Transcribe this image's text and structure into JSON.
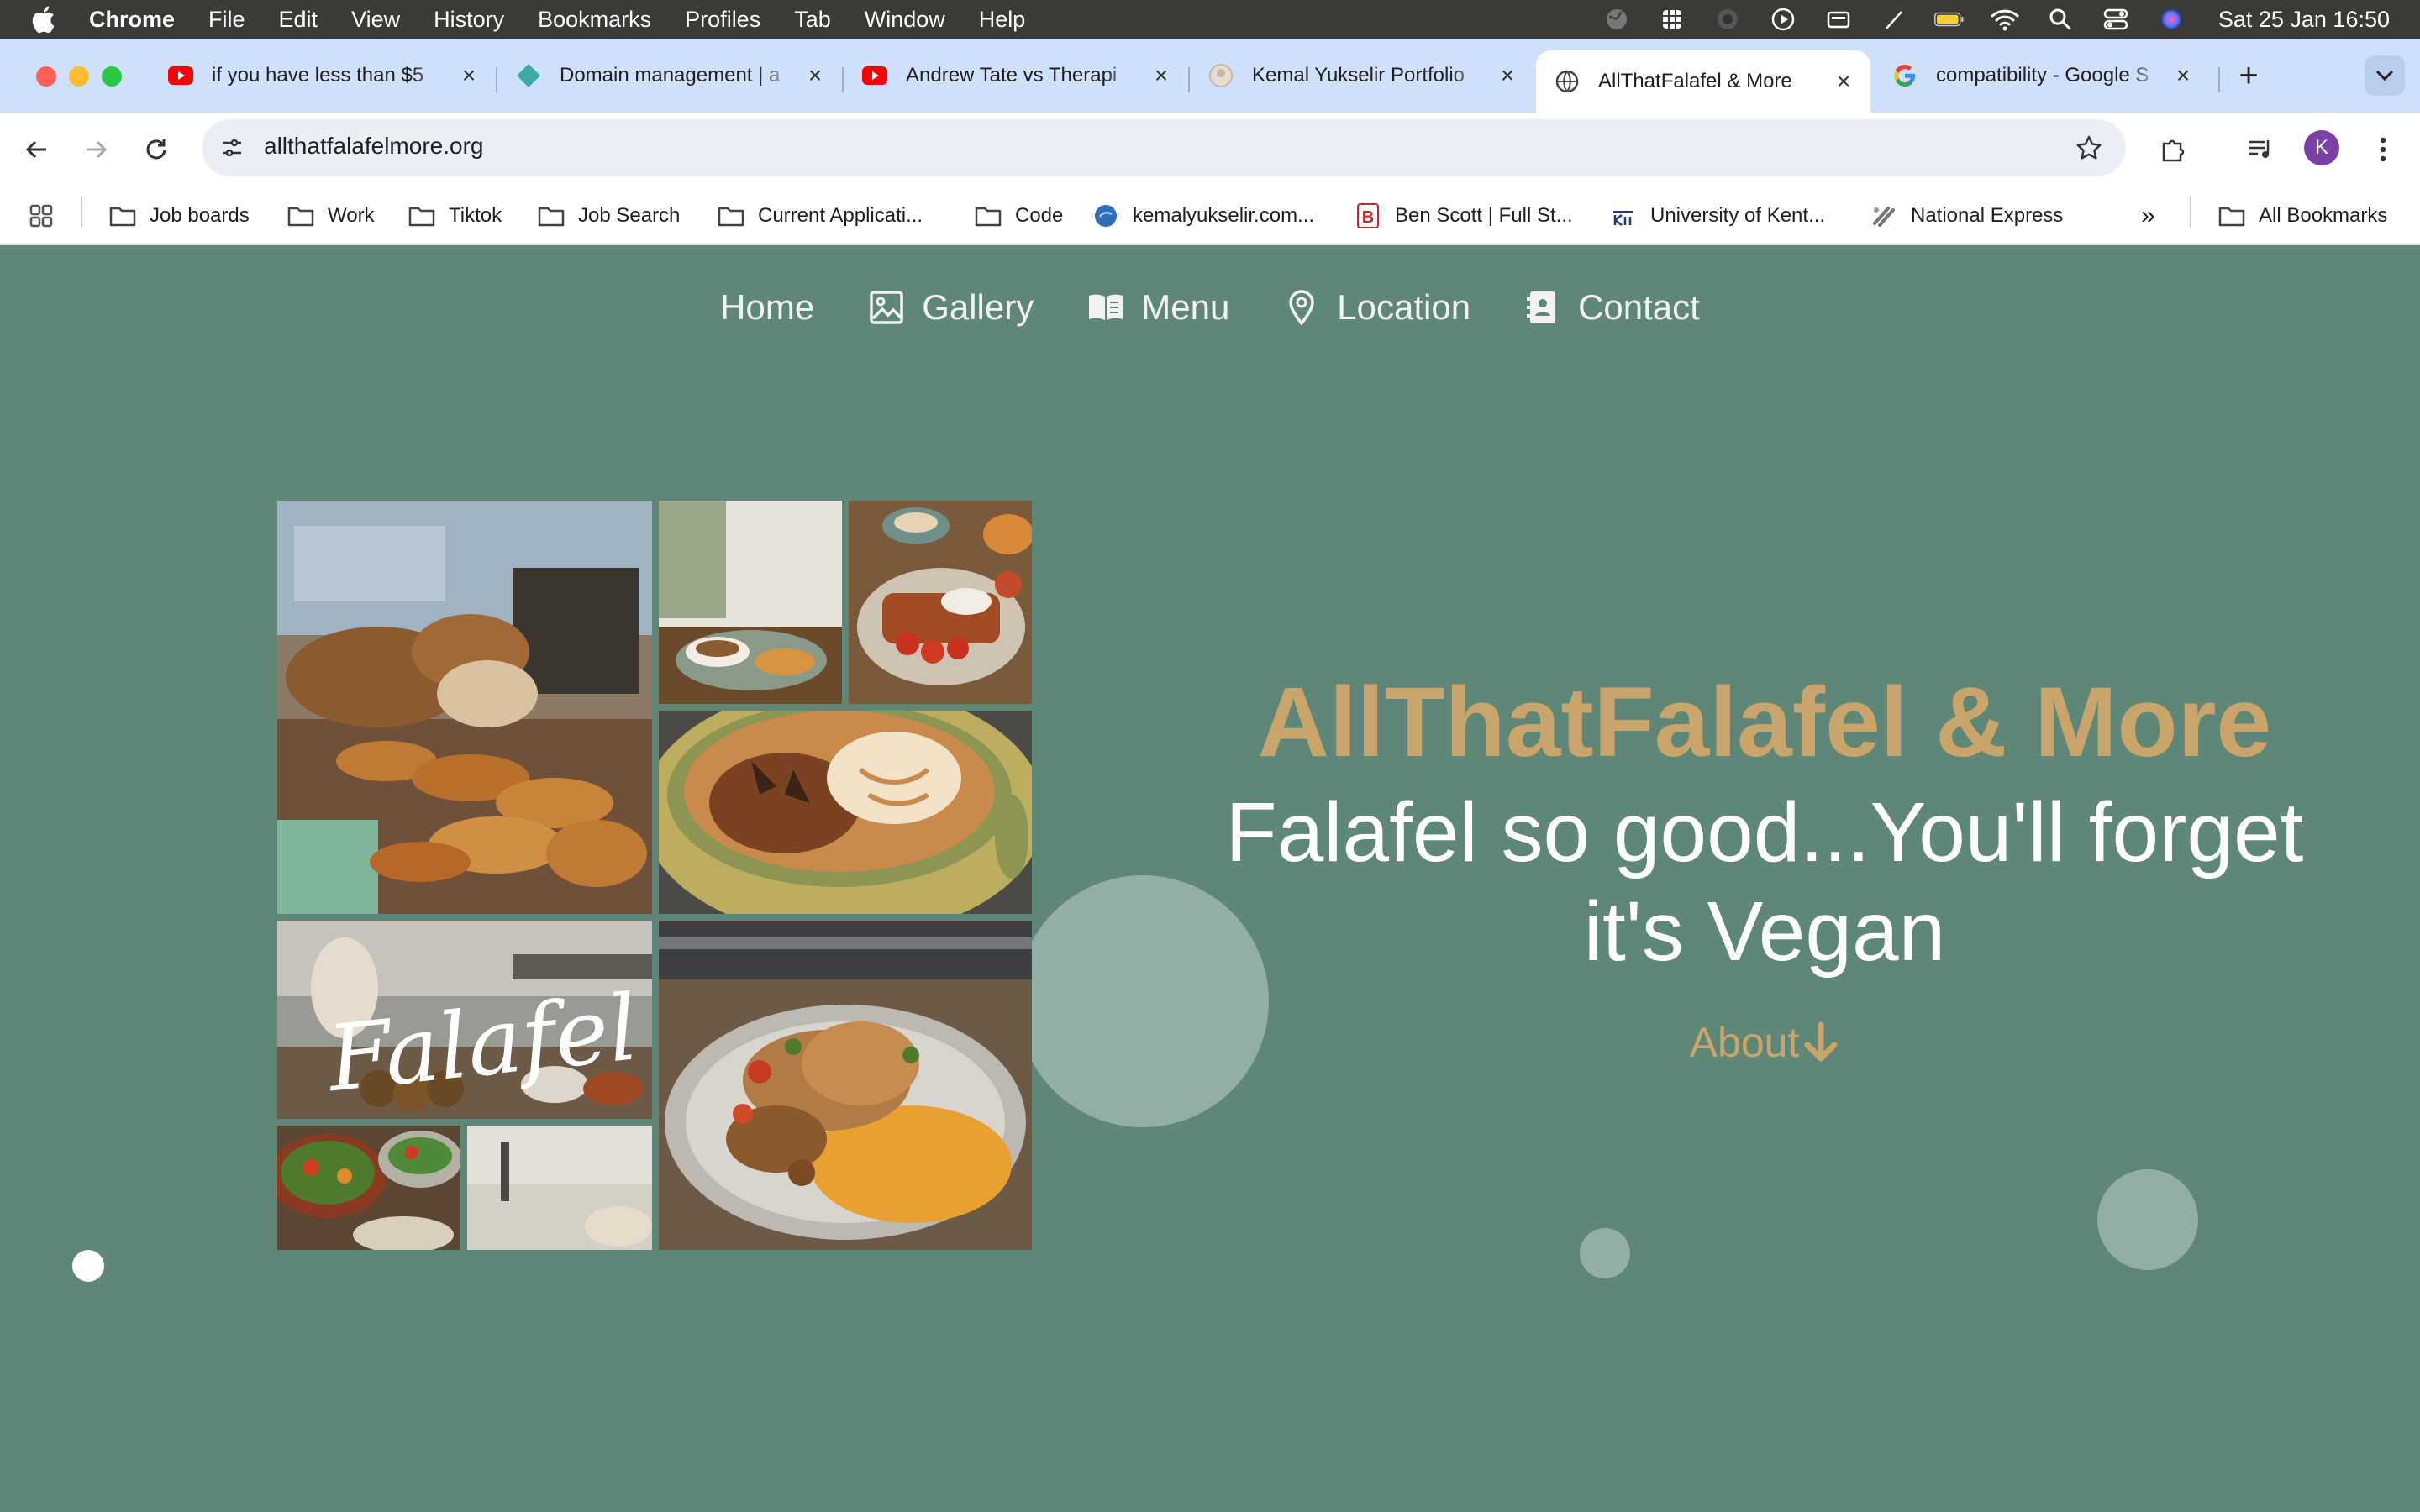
{
  "menubar": {
    "app": "Chrome",
    "items": [
      "File",
      "Edit",
      "View",
      "History",
      "Bookmarks",
      "Profiles",
      "Tab",
      "Window",
      "Help"
    ],
    "clock": "Sat 25 Jan  16:50"
  },
  "tabs": [
    {
      "title": "if you have less than $5",
      "favicon": "youtube-icon"
    },
    {
      "title": "Domain management | a",
      "favicon": "domain-diamond-icon"
    },
    {
      "title": "Andrew Tate vs Therapi",
      "favicon": "youtube-icon"
    },
    {
      "title": "Kemal Yukselir Portfolio",
      "favicon": "portfolio-icon"
    },
    {
      "title": "AllThatFalafel & More",
      "favicon": "globe-icon"
    },
    {
      "title": "compatibility - Google S",
      "favicon": "google-icon"
    }
  ],
  "address_bar": {
    "url": "allthatfalafelmore.org"
  },
  "profile_initial": "K",
  "bookmarks": [
    {
      "label": "Job boards",
      "icon": "folder-icon"
    },
    {
      "label": "Work",
      "icon": "folder-icon"
    },
    {
      "label": "Tiktok",
      "icon": "folder-icon"
    },
    {
      "label": "Job Search",
      "icon": "folder-icon"
    },
    {
      "label": "Current Applicati...",
      "icon": "folder-icon"
    },
    {
      "label": "Code",
      "icon": "folder-icon"
    },
    {
      "label": "kemalyukselir.com...",
      "icon": "site-icon"
    },
    {
      "label": "Ben Scott | Full St...",
      "icon": "b-logo-icon"
    },
    {
      "label": "University of Kent...",
      "icon": "kent-logo-icon"
    },
    {
      "label": "National Express",
      "icon": "national-express-icon"
    }
  ],
  "bookmarks_overflow": "»",
  "all_bookmarks": "All Bookmarks",
  "site": {
    "nav": [
      {
        "label": "Home",
        "icon": ""
      },
      {
        "label": "Gallery",
        "icon": "image-icon"
      },
      {
        "label": "Menu",
        "icon": "book-icon"
      },
      {
        "label": "Location",
        "icon": "map-pin-icon"
      },
      {
        "label": "Contact",
        "icon": "contact-card-icon"
      }
    ],
    "hero_title": "AllThatFalafel & More",
    "tagline_line1": "Falafel so good...You'll forget",
    "tagline_line2": "it's Vegan",
    "about_label": "About",
    "falafel_script": "Falafel",
    "colors": {
      "background": "#5e8778",
      "accent_gold": "#c9a56b",
      "text_white": "#ffffff"
    }
  }
}
